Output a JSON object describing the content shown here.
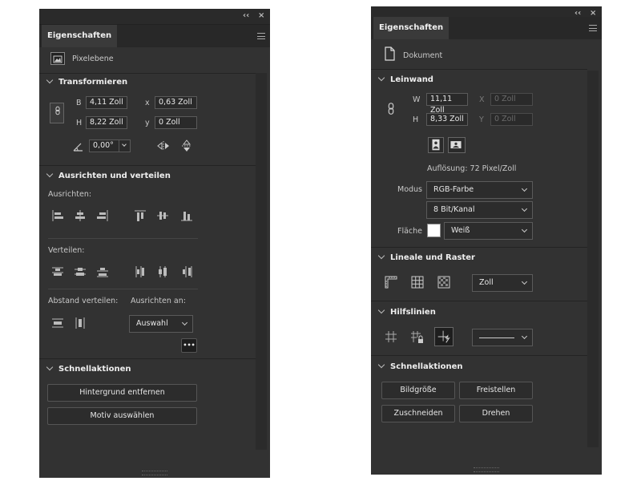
{
  "left_panel": {
    "tab": "Eigenschaften",
    "layer_type": "Pixelebene",
    "transform": {
      "title": "Transformieren",
      "w_label": "B",
      "w_value": "4,11 Zoll",
      "h_label": "H",
      "h_value": "8,22 Zoll",
      "x_label": "x",
      "x_value": "0,63 Zoll",
      "y_label": "y",
      "y_value": "0 Zoll",
      "angle": "0,00°"
    },
    "align": {
      "title": "Ausrichten und verteilen",
      "align_label": "Ausrichten:",
      "distribute_label": "Verteilen:",
      "spacing_label": "Abstand verteilen:",
      "align_to_label": "Ausrichten an:",
      "align_to_value": "Auswahl",
      "more": "•••"
    },
    "quick": {
      "title": "Schnellaktionen",
      "buttons": [
        "Hintergrund entfernen",
        "Motiv auswählen"
      ]
    }
  },
  "right_panel": {
    "tab": "Eigenschaften",
    "doc_type": "Dokument",
    "canvas": {
      "title": "Leinwand",
      "w_label": "W",
      "w_value": "11,11 Zoll",
      "h_label": "H",
      "h_value": "8,33 Zoll",
      "x_label": "X",
      "x_value": "0 Zoll",
      "y_label": "Y",
      "y_value": "0 Zoll",
      "resolution": "Auflösung: 72 Pixel/Zoll",
      "mode_label": "Modus",
      "mode_value": "RGB-Farbe",
      "bit_value": "8 Bit/Kanal",
      "fill_label": "Fläche",
      "fill_value": "Weiß"
    },
    "rulers": {
      "title": "Lineale und Raster",
      "unit": "Zoll"
    },
    "guides": {
      "title": "Hilfslinien"
    },
    "quick": {
      "title": "Schnellaktionen",
      "buttons": [
        "Bildgröße",
        "Freistellen",
        "Zuschneiden",
        "Drehen"
      ]
    }
  },
  "window_buttons": {
    "collapse": "‹‹",
    "close": "×"
  }
}
